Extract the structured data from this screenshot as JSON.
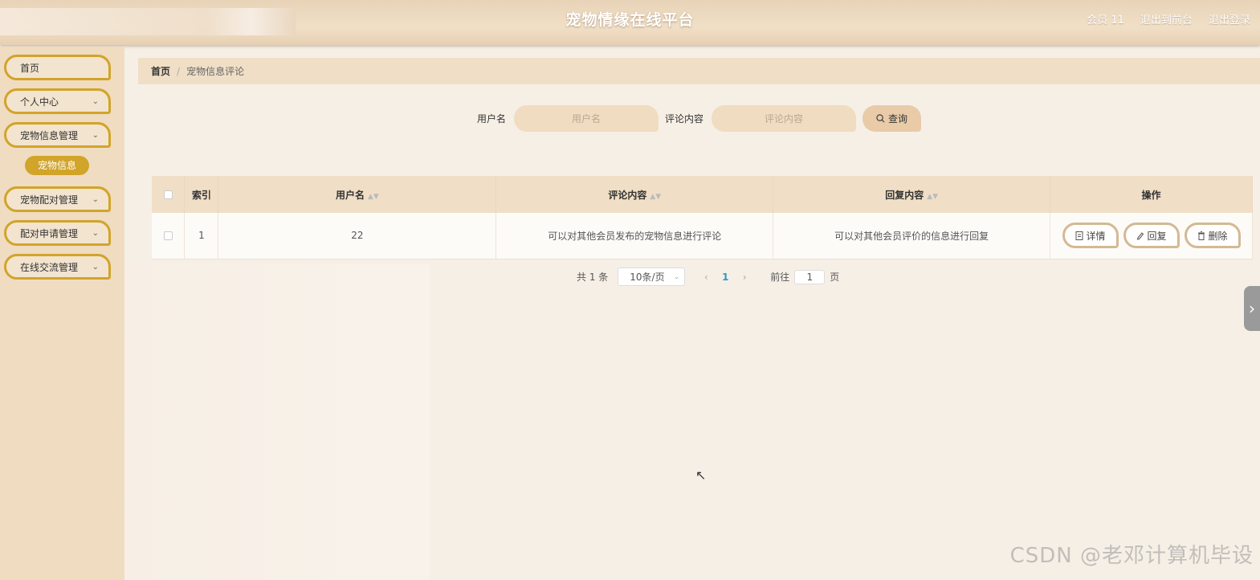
{
  "header": {
    "title": "宠物情缘在线平台",
    "user": "会员 11",
    "back_to_front": "退出到前台",
    "logout": "退出登录"
  },
  "sidebar": {
    "items": [
      {
        "label": "首页"
      },
      {
        "label": "个人中心"
      },
      {
        "label": "宠物信息管理"
      },
      {
        "label": "宠物配对管理"
      },
      {
        "label": "配对申请管理"
      },
      {
        "label": "在线交流管理"
      }
    ],
    "active_sub": "宠物信息"
  },
  "breadcrumb": {
    "home": "首页",
    "separator": "/",
    "current": "宠物信息评论"
  },
  "search": {
    "username_label": "用户名",
    "username_placeholder": "用户名",
    "content_label": "评论内容",
    "content_placeholder": "评论内容",
    "query_label": "查询"
  },
  "table": {
    "headers": {
      "index": "索引",
      "username": "用户名",
      "comment": "评论内容",
      "reply": "回复内容",
      "actions": "操作"
    },
    "rows": [
      {
        "index": "1",
        "username": "22",
        "comment": "可以对其他会员发布的宠物信息进行评论",
        "reply": "可以对其他会员评价的信息进行回复"
      }
    ],
    "actions": {
      "detail": "详情",
      "reply": "回复",
      "delete": "删除"
    }
  },
  "pagination": {
    "total": "共 1 条",
    "page_size": "10条/页",
    "current_page": "1",
    "goto_label": "前往",
    "goto_value": "1",
    "page_suffix": "页"
  },
  "watermark": "CSDN @老邓计算机毕设"
}
